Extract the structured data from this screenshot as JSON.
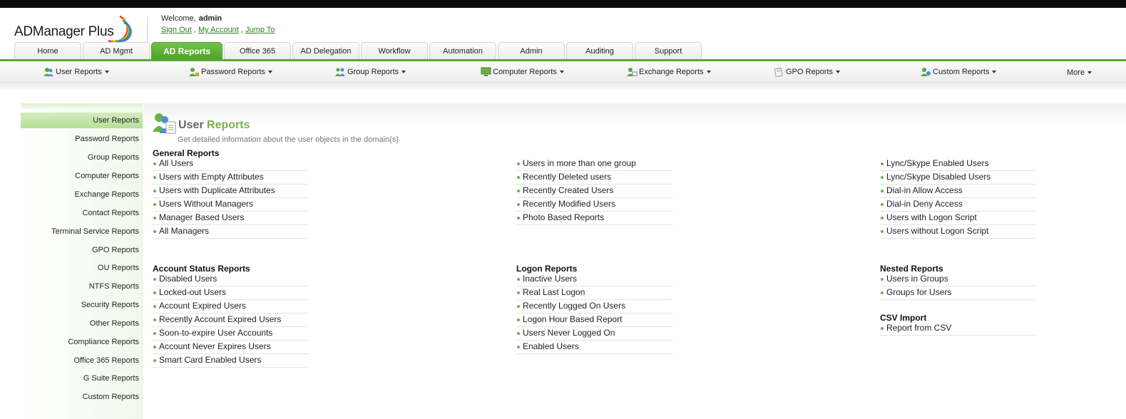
{
  "header": {
    "logo_text": "ADManager Plus",
    "welcome_label": "Welcome,",
    "username": "admin",
    "links": {
      "sign_out": "Sign Out",
      "my_account": "My Account",
      "jump_to": "Jump To",
      "separator": ","
    }
  },
  "tabs": [
    {
      "label": "Home"
    },
    {
      "label": "AD Mgmt"
    },
    {
      "label": "AD Reports"
    },
    {
      "label": "Office 365"
    },
    {
      "label": "AD Delegation"
    },
    {
      "label": "Workflow"
    },
    {
      "label": "Automation"
    },
    {
      "label": "Admin"
    },
    {
      "label": "Auditing"
    },
    {
      "label": "Support"
    }
  ],
  "subnav": [
    {
      "label": "User Reports",
      "icon": "users-icon"
    },
    {
      "label": "Password Reports",
      "icon": "password-users-icon"
    },
    {
      "label": "Group Reports",
      "icon": "group-icon"
    },
    {
      "label": "Computer Reports",
      "icon": "computer-icon"
    },
    {
      "label": "Exchange Reports",
      "icon": "exchange-icon"
    },
    {
      "label": "GPO Reports",
      "icon": "gpo-icon"
    },
    {
      "label": "Custom Reports",
      "icon": "custom-reports-icon"
    },
    {
      "label": "More"
    }
  ],
  "sidebar": [
    {
      "label": "User Reports"
    },
    {
      "label": "Password Reports"
    },
    {
      "label": "Group Reports"
    },
    {
      "label": "Computer Reports"
    },
    {
      "label": "Exchange Reports"
    },
    {
      "label": "Contact Reports"
    },
    {
      "label": "Terminal Service Reports"
    },
    {
      "label": "GPO Reports"
    },
    {
      "label": "OU Reports"
    },
    {
      "label": "NTFS Reports"
    },
    {
      "label": "Security Reports"
    },
    {
      "label": "Other Reports"
    },
    {
      "label": "Compliance Reports"
    },
    {
      "label": "Office 365 Reports"
    },
    {
      "label": "G Suite Reports"
    },
    {
      "label": "Custom Reports"
    }
  ],
  "main": {
    "title_part1": "User",
    "title_part2": "Reports",
    "description": "Get detailed information about the user objects in the domain(s)",
    "sections": {
      "general": {
        "title": "General Reports",
        "col1": [
          "All Users",
          "Users with Empty Attributes",
          "Users with Duplicate Attributes",
          "Users Without Managers",
          "Manager Based Users",
          "All Managers"
        ],
        "col2": [
          "Users in more than one group",
          "Recently Deleted users",
          "Recently Created Users",
          "Recently Modified Users",
          "Photo Based Reports"
        ],
        "col3": [
          "Lync/Skype Enabled Users",
          "Lync/Skype Disabled Users",
          "Dial-in Allow Access",
          "Dial-in Deny Access",
          "Users with Logon Script",
          "Users without Logon Script"
        ]
      },
      "account_status": {
        "title": "Account Status Reports",
        "items": [
          "Disabled Users",
          "Locked-out Users",
          "Account Expired Users",
          "Recently Account Expired Users",
          "Soon-to-expire User Accounts",
          "Account Never Expires Users",
          "Smart Card Enabled Users"
        ]
      },
      "logon": {
        "title": "Logon Reports",
        "items": [
          "Inactive Users",
          "Real Last Logon",
          "Recently Logged On Users",
          "Logon Hour Based Report",
          "Users Never Logged On",
          "Enabled Users"
        ]
      },
      "nested": {
        "title": "Nested Reports",
        "items": [
          "Users in Groups",
          "Groups for Users"
        ]
      },
      "csv": {
        "title": "CSV Import",
        "items": [
          "Report from CSV"
        ]
      }
    }
  },
  "colors": {
    "accent_green": "#56ab2f",
    "active_tab": "#5cb337",
    "link_green": "#2e7d1f",
    "bullet": "#6ab04c",
    "title_accent": "#7cb04a"
  }
}
